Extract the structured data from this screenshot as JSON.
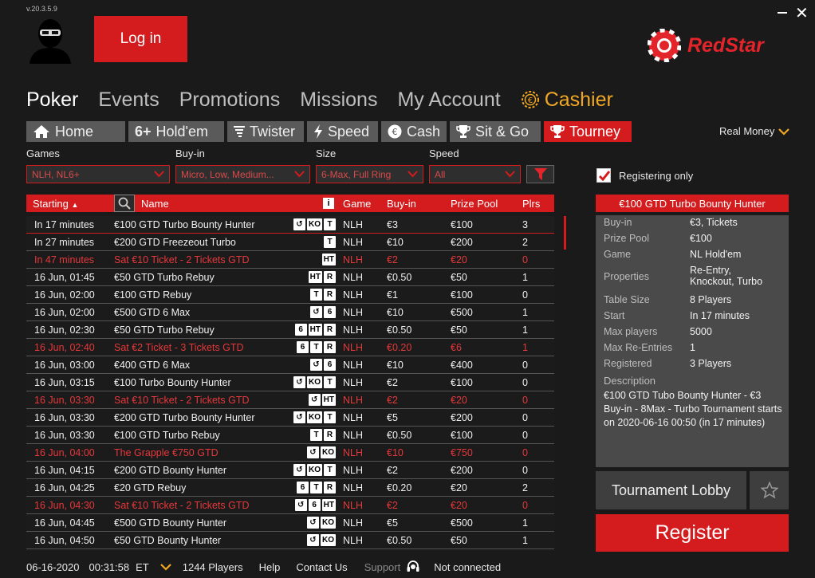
{
  "version": "v.20.3.5.9",
  "header": {
    "login_label": "Log in",
    "logo_text": "RedStar"
  },
  "main_nav": [
    "Poker",
    "Events",
    "Promotions",
    "Missions",
    "My Account",
    "Cashier"
  ],
  "sub_nav": [
    "Home",
    "Hold'em",
    "Twister",
    "Speed",
    "Cash",
    "Sit & Go",
    "Tourney"
  ],
  "real_money": "Real Money",
  "filters": {
    "games": {
      "label": "Games",
      "value": "NLH, NL6+"
    },
    "buyin": {
      "label": "Buy-in",
      "value": "Micro, Low, Medium..."
    },
    "size": {
      "label": "Size",
      "value": "6-Max, Full Ring"
    },
    "speed": {
      "label": "Speed",
      "value": "All"
    }
  },
  "registering_only": "Registering only",
  "columns": [
    "Starting",
    "Name",
    "Game",
    "Buy-in",
    "Prize Pool",
    "Plrs"
  ],
  "rows": [
    {
      "start": "In 17 minutes",
      "name": "€100 GTD Turbo Bounty Hunter",
      "badges": [
        "↺",
        "KO",
        "T"
      ],
      "game": "NLH",
      "buyin": "€3",
      "prize": "€100",
      "plrs": "3",
      "red": false,
      "sel": true
    },
    {
      "start": "In 27 minutes",
      "name": "€200 GTD Freezeout Turbo",
      "badges": [
        "T"
      ],
      "game": "NLH",
      "buyin": "€10",
      "prize": "€200",
      "plrs": "2",
      "red": false
    },
    {
      "start": "In 47 minutes",
      "name": "Sat €10 Ticket - 2 Tickets GTD",
      "badges": [
        "HT"
      ],
      "game": "NLH",
      "buyin": "€2",
      "prize": "€20",
      "plrs": "0",
      "red": true
    },
    {
      "start": "16 Jun, 01:45",
      "name": "€50 GTD Turbo Rebuy",
      "badges": [
        "HT",
        "R"
      ],
      "game": "NLH",
      "buyin": "€0.50",
      "prize": "€50",
      "plrs": "1",
      "red": false
    },
    {
      "start": "16 Jun, 02:00",
      "name": "€100 GTD Rebuy",
      "badges": [
        "T",
        "R"
      ],
      "game": "NLH",
      "buyin": "€1",
      "prize": "€100",
      "plrs": "0",
      "red": false
    },
    {
      "start": "16 Jun, 02:00",
      "name": "€500 GTD 6 Max",
      "badges": [
        "↺",
        "6"
      ],
      "game": "NLH",
      "buyin": "€10",
      "prize": "€500",
      "plrs": "1",
      "red": false
    },
    {
      "start": "16 Jun, 02:30",
      "name": "€50 GTD Turbo Rebuy",
      "badges": [
        "6",
        "HT",
        "R"
      ],
      "game": "NLH",
      "buyin": "€0.50",
      "prize": "€50",
      "plrs": "1",
      "red": false
    },
    {
      "start": "16 Jun, 02:40",
      "name": "Sat €2 Ticket - 3 Tickets GTD",
      "badges": [
        "6",
        "T",
        "R"
      ],
      "game": "NLH",
      "buyin": "€0.20",
      "prize": "€6",
      "plrs": "1",
      "red": true
    },
    {
      "start": "16 Jun, 03:00",
      "name": "€400 GTD 6 Max",
      "badges": [
        "↺",
        "6"
      ],
      "game": "NLH",
      "buyin": "€10",
      "prize": "€400",
      "plrs": "0",
      "red": false
    },
    {
      "start": "16 Jun, 03:15",
      "name": "€100 Turbo Bounty Hunter",
      "badges": [
        "↺",
        "KO",
        "T"
      ],
      "game": "NLH",
      "buyin": "€2",
      "prize": "€100",
      "plrs": "0",
      "red": false
    },
    {
      "start": "16 Jun, 03:30",
      "name": "Sat €10 Ticket - 2 Tickets GTD",
      "badges": [
        "↺",
        "HT"
      ],
      "game": "NLH",
      "buyin": "€2",
      "prize": "€20",
      "plrs": "0",
      "red": true
    },
    {
      "start": "16 Jun, 03:30",
      "name": "€200 GTD Turbo Bounty Hunter",
      "badges": [
        "↺",
        "KO",
        "T"
      ],
      "game": "NLH",
      "buyin": "€5",
      "prize": "€200",
      "plrs": "0",
      "red": false
    },
    {
      "start": "16 Jun, 03:30",
      "name": "€100 GTD Turbo Rebuy",
      "badges": [
        "T",
        "R"
      ],
      "game": "NLH",
      "buyin": "€0.50",
      "prize": "€100",
      "plrs": "0",
      "red": false
    },
    {
      "start": "16 Jun, 04:00",
      "name": "The Grapple €750 GTD",
      "badges": [
        "↺",
        "KO"
      ],
      "game": "NLH",
      "buyin": "€10",
      "prize": "€750",
      "plrs": "0",
      "red": true
    },
    {
      "start": "16 Jun, 04:15",
      "name": "€200 GTD Bounty Hunter",
      "badges": [
        "↺",
        "KO",
        "T"
      ],
      "game": "NLH",
      "buyin": "€2",
      "prize": "€200",
      "plrs": "0",
      "red": false
    },
    {
      "start": "16 Jun, 04:25",
      "name": "€20 GTD Rebuy",
      "badges": [
        "6",
        "T",
        "R"
      ],
      "game": "NLH",
      "buyin": "€0.20",
      "prize": "€20",
      "plrs": "2",
      "red": false
    },
    {
      "start": "16 Jun, 04:30",
      "name": "Sat €10 Ticket - 2 Tickets GTD",
      "badges": [
        "↺",
        "6",
        "HT"
      ],
      "game": "NLH",
      "buyin": "€2",
      "prize": "€20",
      "plrs": "0",
      "red": true
    },
    {
      "start": "16 Jun, 04:45",
      "name": "€500 GTD Bounty Hunter",
      "badges": [
        "↺",
        "KO"
      ],
      "game": "NLH",
      "buyin": "€5",
      "prize": "€500",
      "plrs": "1",
      "red": false
    },
    {
      "start": "16 Jun, 04:50",
      "name": "€50 GTD Bounty Hunter",
      "badges": [
        "↺",
        "KO"
      ],
      "game": "NLH",
      "buyin": "€0.50",
      "prize": "€50",
      "plrs": "1",
      "red": false
    }
  ],
  "detail": {
    "title": "€100 GTD Turbo Bounty Hunter",
    "fields": [
      {
        "k": "Buy-in",
        "v": "€3, Tickets"
      },
      {
        "k": "Prize Pool",
        "v": "€100"
      },
      {
        "k": "Game",
        "v": "NL Hold'em"
      },
      {
        "k": "Properties",
        "v": "Re-Entry,\nKnockout, Turbo"
      },
      {
        "k": "Table Size",
        "v": "8 Players"
      },
      {
        "k": "Start",
        "v": "In 17 minutes"
      },
      {
        "k": "Max players",
        "v": "5000"
      },
      {
        "k": "Max Re-Entries",
        "v": "1"
      },
      {
        "k": "Registered",
        "v": "3 Players"
      }
    ],
    "description_label": "Description",
    "description": "€100 GTD Tubo Bounty Hunter - €3 Buy-in - 8Max - Turbo Tournament starts on 2020-06-16 00:50 (in 17 minutes)"
  },
  "buttons": {
    "lobby": "Tournament Lobby",
    "register": "Register"
  },
  "footer": {
    "date": "06-16-2020",
    "time": "00:31:58",
    "tz": "ET",
    "players": "1244 Players",
    "help": "Help",
    "contact": "Contact Us",
    "support": "Support",
    "status": "Not connected"
  }
}
